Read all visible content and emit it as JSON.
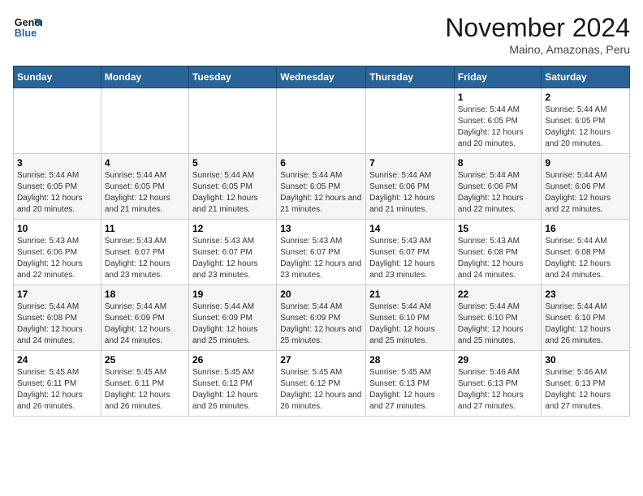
{
  "logo": {
    "line1": "General",
    "line2": "Blue"
  },
  "title": "November 2024",
  "location": "Maino, Amazonas, Peru",
  "days_of_week": [
    "Sunday",
    "Monday",
    "Tuesday",
    "Wednesday",
    "Thursday",
    "Friday",
    "Saturday"
  ],
  "weeks": [
    [
      {
        "day": "",
        "info": ""
      },
      {
        "day": "",
        "info": ""
      },
      {
        "day": "",
        "info": ""
      },
      {
        "day": "",
        "info": ""
      },
      {
        "day": "",
        "info": ""
      },
      {
        "day": "1",
        "info": "Sunrise: 5:44 AM\nSunset: 6:05 PM\nDaylight: 12 hours and 20 minutes."
      },
      {
        "day": "2",
        "info": "Sunrise: 5:44 AM\nSunset: 6:05 PM\nDaylight: 12 hours and 20 minutes."
      }
    ],
    [
      {
        "day": "3",
        "info": "Sunrise: 5:44 AM\nSunset: 6:05 PM\nDaylight: 12 hours and 20 minutes."
      },
      {
        "day": "4",
        "info": "Sunrise: 5:44 AM\nSunset: 6:05 PM\nDaylight: 12 hours and 21 minutes."
      },
      {
        "day": "5",
        "info": "Sunrise: 5:44 AM\nSunset: 6:05 PM\nDaylight: 12 hours and 21 minutes."
      },
      {
        "day": "6",
        "info": "Sunrise: 5:44 AM\nSunset: 6:05 PM\nDaylight: 12 hours and 21 minutes."
      },
      {
        "day": "7",
        "info": "Sunrise: 5:44 AM\nSunset: 6:06 PM\nDaylight: 12 hours and 21 minutes."
      },
      {
        "day": "8",
        "info": "Sunrise: 5:44 AM\nSunset: 6:06 PM\nDaylight: 12 hours and 22 minutes."
      },
      {
        "day": "9",
        "info": "Sunrise: 5:44 AM\nSunset: 6:06 PM\nDaylight: 12 hours and 22 minutes."
      }
    ],
    [
      {
        "day": "10",
        "info": "Sunrise: 5:43 AM\nSunset: 6:06 PM\nDaylight: 12 hours and 22 minutes."
      },
      {
        "day": "11",
        "info": "Sunrise: 5:43 AM\nSunset: 6:07 PM\nDaylight: 12 hours and 23 minutes."
      },
      {
        "day": "12",
        "info": "Sunrise: 5:43 AM\nSunset: 6:07 PM\nDaylight: 12 hours and 23 minutes."
      },
      {
        "day": "13",
        "info": "Sunrise: 5:43 AM\nSunset: 6:07 PM\nDaylight: 12 hours and 23 minutes."
      },
      {
        "day": "14",
        "info": "Sunrise: 5:43 AM\nSunset: 6:07 PM\nDaylight: 12 hours and 23 minutes."
      },
      {
        "day": "15",
        "info": "Sunrise: 5:43 AM\nSunset: 6:08 PM\nDaylight: 12 hours and 24 minutes."
      },
      {
        "day": "16",
        "info": "Sunrise: 5:44 AM\nSunset: 6:08 PM\nDaylight: 12 hours and 24 minutes."
      }
    ],
    [
      {
        "day": "17",
        "info": "Sunrise: 5:44 AM\nSunset: 6:08 PM\nDaylight: 12 hours and 24 minutes."
      },
      {
        "day": "18",
        "info": "Sunrise: 5:44 AM\nSunset: 6:09 PM\nDaylight: 12 hours and 24 minutes."
      },
      {
        "day": "19",
        "info": "Sunrise: 5:44 AM\nSunset: 6:09 PM\nDaylight: 12 hours and 25 minutes."
      },
      {
        "day": "20",
        "info": "Sunrise: 5:44 AM\nSunset: 6:09 PM\nDaylight: 12 hours and 25 minutes."
      },
      {
        "day": "21",
        "info": "Sunrise: 5:44 AM\nSunset: 6:10 PM\nDaylight: 12 hours and 25 minutes."
      },
      {
        "day": "22",
        "info": "Sunrise: 5:44 AM\nSunset: 6:10 PM\nDaylight: 12 hours and 25 minutes."
      },
      {
        "day": "23",
        "info": "Sunrise: 5:44 AM\nSunset: 6:10 PM\nDaylight: 12 hours and 26 minutes."
      }
    ],
    [
      {
        "day": "24",
        "info": "Sunrise: 5:45 AM\nSunset: 6:11 PM\nDaylight: 12 hours and 26 minutes."
      },
      {
        "day": "25",
        "info": "Sunrise: 5:45 AM\nSunset: 6:11 PM\nDaylight: 12 hours and 26 minutes."
      },
      {
        "day": "26",
        "info": "Sunrise: 5:45 AM\nSunset: 6:12 PM\nDaylight: 12 hours and 26 minutes."
      },
      {
        "day": "27",
        "info": "Sunrise: 5:45 AM\nSunset: 6:12 PM\nDaylight: 12 hours and 26 minutes."
      },
      {
        "day": "28",
        "info": "Sunrise: 5:45 AM\nSunset: 6:13 PM\nDaylight: 12 hours and 27 minutes."
      },
      {
        "day": "29",
        "info": "Sunrise: 5:46 AM\nSunset: 6:13 PM\nDaylight: 12 hours and 27 minutes."
      },
      {
        "day": "30",
        "info": "Sunrise: 5:46 AM\nSunset: 6:13 PM\nDaylight: 12 hours and 27 minutes."
      }
    ]
  ]
}
